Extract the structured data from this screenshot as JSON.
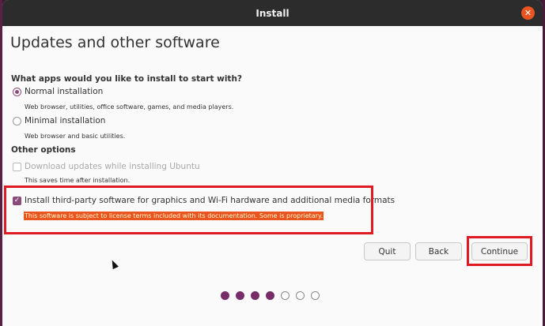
{
  "window": {
    "title": "Install",
    "close_icon": "close-icon",
    "close_glyph": "✕"
  },
  "page": {
    "title": "Updates and other software"
  },
  "apps": {
    "question": "What apps would you like to install to start with?",
    "options": [
      {
        "label": "Normal installation",
        "desc": "Web browser, utilities, office software, games, and media players.",
        "checked": true
      },
      {
        "label": "Minimal installation",
        "desc": "Web browser and basic utilities.",
        "checked": false
      }
    ]
  },
  "other": {
    "heading": "Other options",
    "download_updates": {
      "label": "Download updates while installing Ubuntu",
      "desc": "This saves time after installation.",
      "checked": false,
      "enabled": false
    },
    "third_party": {
      "label": "Install third-party software for graphics and Wi-Fi hardware and additional media formats",
      "warning": "This software is subject to license terms included with its documentation. Some is proprietary.",
      "checked": true,
      "check_glyph": "✓"
    }
  },
  "buttons": {
    "quit": "Quit",
    "back": "Back",
    "continue": "Continue"
  },
  "progress": {
    "steps_total": 7,
    "steps_done": 4
  },
  "colors": {
    "accent": "#772d68",
    "highlight": "#e01a22",
    "warning_bg": "#e9541f",
    "titlebar": "#2c2c2c"
  }
}
